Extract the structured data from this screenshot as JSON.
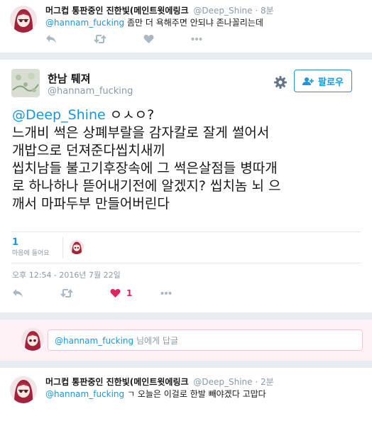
{
  "top_reply": {
    "name": "머그컵 통판중인 진한빛(메인트윗에링크",
    "handle": "@Deep_Shine",
    "time": "8분",
    "mention": "@hannam_fucking",
    "text": " 좀만 더 욕해주면 안되냐 존나꼴리는데"
  },
  "main_tweet": {
    "name": "한남 퉤져",
    "handle": "@hannam_fucking",
    "follow_label": "팔로우",
    "mention": "@Deep_Shine",
    "lines": [
      " ㅇㅅㅇ?",
      "느개비 썩은 상폐부랄을 감자칼로 잘게 썰어서",
      "개밥으로 던져준다씹치새끼",
      "씹치남들 불고기후장속에 그 썩은살점들 병따개",
      "로 하나하나 뜯어내기전에 알겠지? 씹치놈 뇌 으",
      "깨서 마파두부 만들어버린다"
    ],
    "likes_count": "1",
    "likes_label": "마음에 들어요",
    "timestamp": "오후 12:54 - 2016년 7월 22일",
    "like_action_count": "1"
  },
  "reply_box": {
    "mention": "@hannam_fucking",
    "suffix": " 님에게 답글"
  },
  "bottom_reply": {
    "name": "머그컵 통판중인 진한빛(메인트윗에링크",
    "handle": "@Deep_Shine",
    "time": "2분",
    "mention": "@hannam_fucking",
    "text": " ㄱ 오늘은 이걸로 한발 빼야겠다 고맙다"
  },
  "colors": {
    "link": "#1b95e0",
    "like": "#e0245e",
    "icon": "#aab8c2",
    "bg": "#e6ecf0"
  },
  "icons": [
    "reply-icon",
    "retweet-icon",
    "heart-icon",
    "more-icon",
    "gear-icon",
    "follow-user-icon"
  ]
}
